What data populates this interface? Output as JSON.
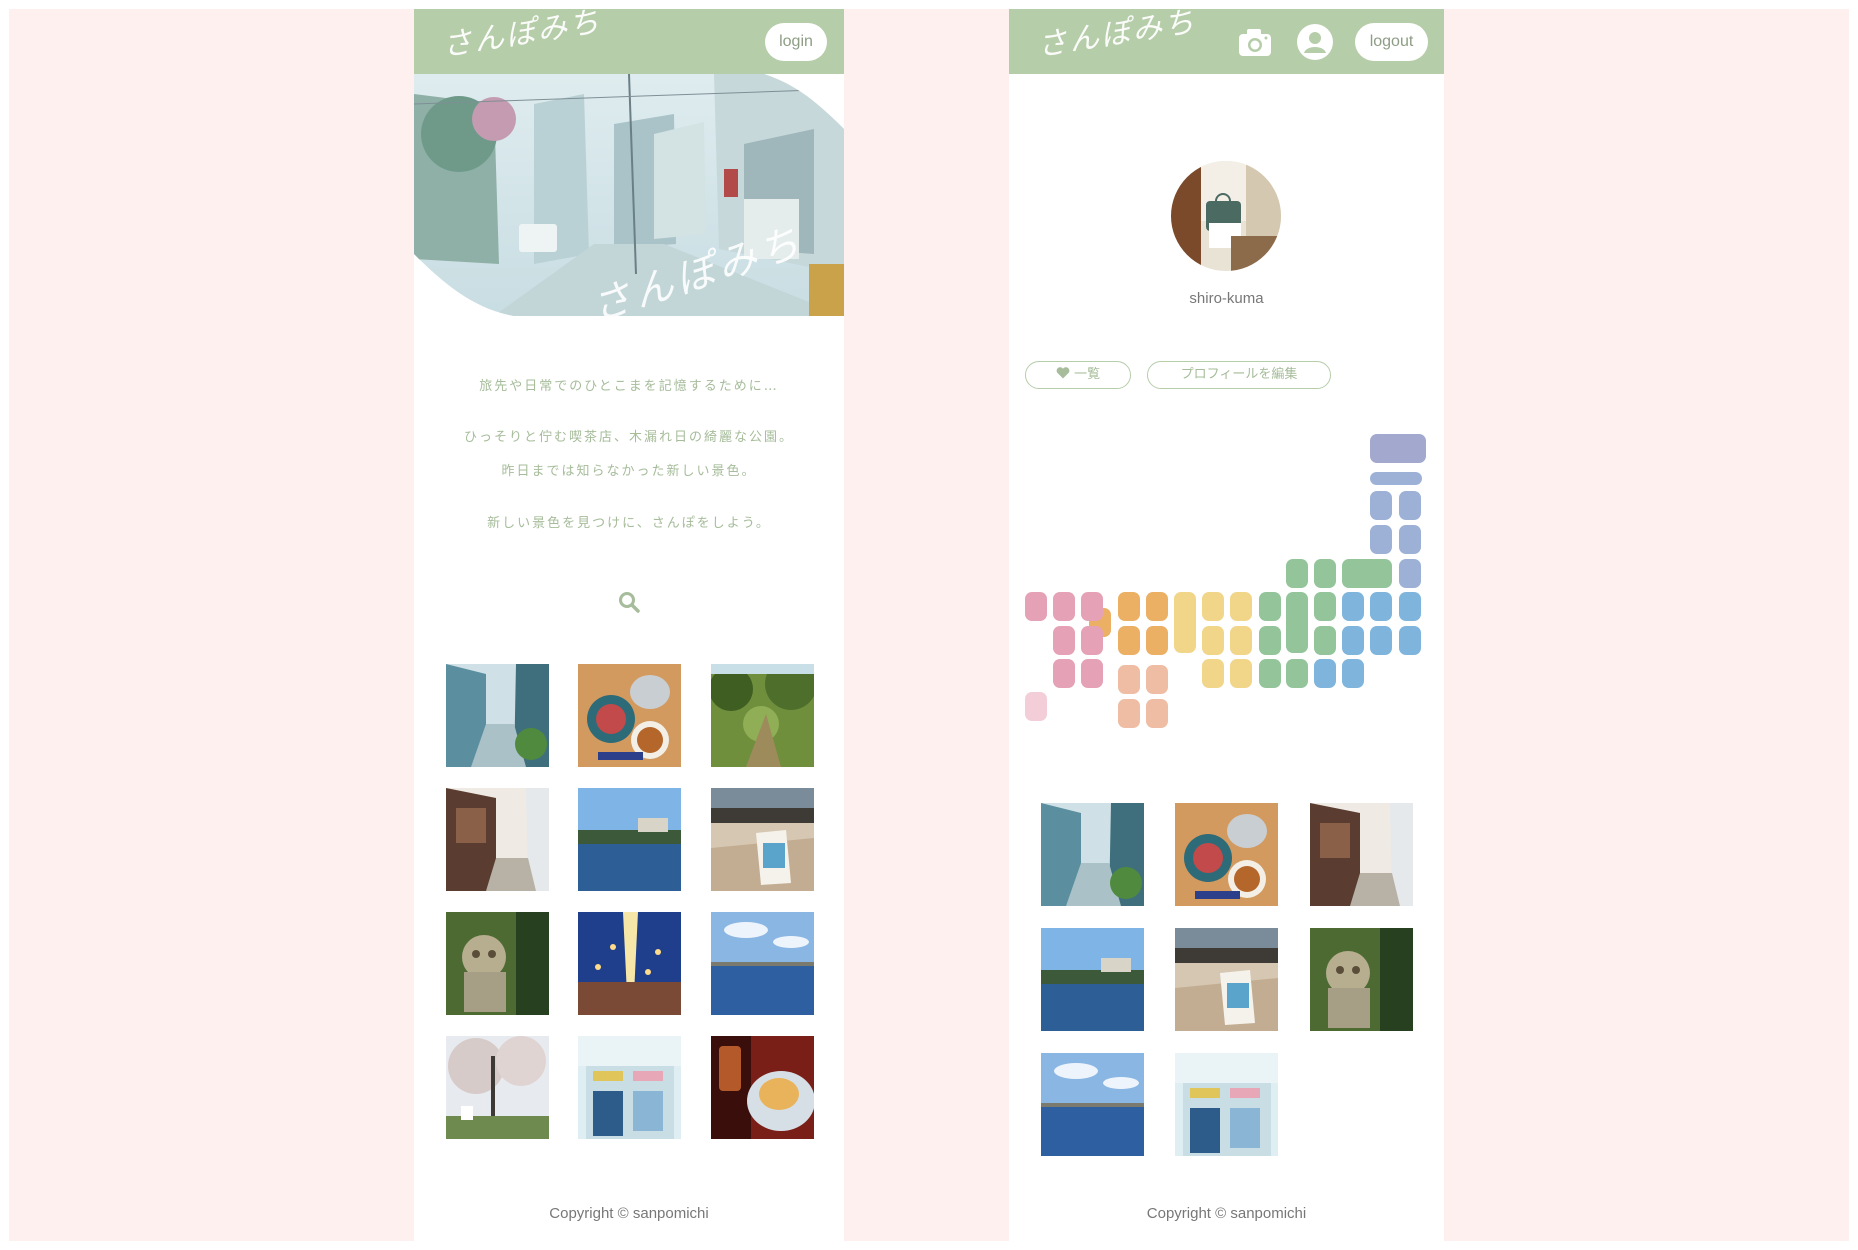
{
  "left": {
    "header": {
      "logo": "さんぽみち",
      "login_label": "login"
    },
    "hero": {
      "script": "さんぽみち"
    },
    "intro": [
      "旅先や日常でのひとこまを記憶するために…",
      "ひっそりと佇む喫茶店、木漏れ日の綺麗な公園。",
      "昨日までは知らなかった新しい景色。",
      "新しい景色を見つけに、さんぽをしよう。"
    ],
    "search_icon": "search-icon",
    "photos": [
      "alley",
      "tea",
      "forest",
      "street",
      "river",
      "cafe-sign",
      "shisa",
      "festival",
      "harbor",
      "blossom",
      "shop",
      "dessert"
    ],
    "footer": "Copyright © sanpomichi"
  },
  "right": {
    "header": {
      "logo": "さんぽみち",
      "camera_icon": "camera-icon",
      "user_icon": "user-icon",
      "logout_label": "logout"
    },
    "profile": {
      "username": "shiro-kuma"
    },
    "buttons": {
      "favorites_label": "一覧",
      "favorites_icon": "heart-icon",
      "edit_label": "プロフィールを編集"
    },
    "photos": [
      "alley",
      "tea",
      "street",
      "river",
      "cafe-sign",
      "shisa",
      "harbor",
      "shop"
    ],
    "footer": "Copyright © sanpomichi"
  },
  "colors": {
    "header": "#b6cdaa",
    "page_bg": "#fdf0ee",
    "hokkaido": "#a3a8cf",
    "tohoku": "#9db1d6",
    "kanto": "#7fb5dc",
    "chubu": "#93c49a",
    "kinki": "#f1d589",
    "chugoku": "#ebb063",
    "shikoku": "#efbca4",
    "kyushu": "#e5a1b5",
    "okinawa": "#f3cdd7"
  }
}
